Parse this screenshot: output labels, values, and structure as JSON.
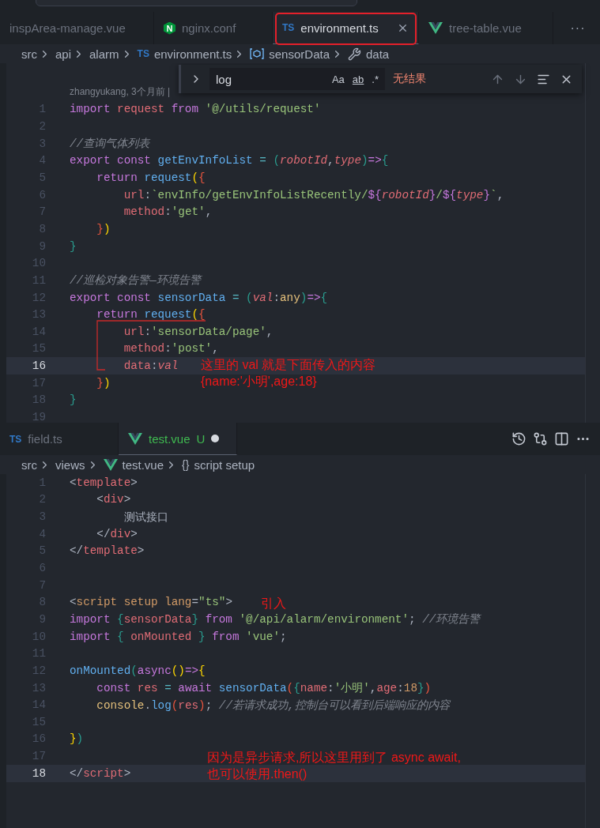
{
  "top_editor": {
    "tabs": [
      {
        "label": "inspArea-manage.vue",
        "selected": false
      },
      {
        "label": "nginx.conf",
        "kind": "nginx",
        "icon_text": "N",
        "selected": false
      },
      {
        "label": "environment.ts",
        "kind": "ts",
        "icon_text": "TS",
        "selected": true,
        "highlighted": true
      },
      {
        "label": "tree-table.vue",
        "kind": "vue",
        "selected": false
      }
    ],
    "more": "···",
    "breadcrumb": [
      {
        "label": "src"
      },
      {
        "label": "api"
      },
      {
        "label": "alarm"
      },
      {
        "label": "environment.ts",
        "kind": "ts",
        "icon_text": "TS"
      },
      {
        "label": "sensorData",
        "kind": "symbol"
      },
      {
        "label": "data",
        "kind": "wrench"
      }
    ],
    "find": {
      "value": "log",
      "options": [
        "Aa",
        "ab",
        ".*"
      ],
      "result": "无结果"
    },
    "blame": "zhangyukang, 3个月前 |",
    "lines": [
      {
        "n": "1",
        "current": false,
        "tokens": [
          {
            "kind": "kw",
            "text": "import "
          },
          {
            "kind": "var",
            "text": "request"
          },
          {
            "kind": "kw",
            "text": " from "
          },
          {
            "kind": "str",
            "text": "'@/utils/request'"
          }
        ]
      },
      {
        "n": "2",
        "current": false
      },
      {
        "n": "3",
        "current": false,
        "tokens": [
          {
            "kind": "comment",
            "text": "//查询气体列表"
          }
        ]
      },
      {
        "n": "4",
        "current": false,
        "tokens": [
          {
            "kind": "kw",
            "text": "export const "
          },
          {
            "kind": "fn",
            "text": "getEnvInfoList"
          },
          {
            "kind": "op",
            "text": " = "
          },
          {
            "kind": "b3",
            "text": "("
          },
          {
            "kind": "param",
            "text": "robotId"
          },
          {
            "kind": "plain",
            "text": ","
          },
          {
            "kind": "param",
            "text": "type"
          },
          {
            "kind": "b3",
            "text": ")"
          },
          {
            "kind": "kw",
            "text": "=>"
          },
          {
            "kind": "b3",
            "text": "{"
          }
        ]
      },
      {
        "n": "5",
        "current": false,
        "tokens": [
          {
            "kind": "kw",
            "text": "    return "
          },
          {
            "kind": "fn",
            "text": "request"
          },
          {
            "kind": "b1",
            "text": "("
          },
          {
            "kind": "b2",
            "text": "{"
          }
        ]
      },
      {
        "n": "6",
        "current": false,
        "tokens": [
          {
            "kind": "prop",
            "text": "        url"
          },
          {
            "kind": "plain",
            "text": ":"
          },
          {
            "kind": "str",
            "text": "`envInfo/getEnvInfoListRecently/"
          },
          {
            "kind": "kw",
            "text": "${"
          },
          {
            "kind": "param",
            "text": "robotId"
          },
          {
            "kind": "kw",
            "text": "}"
          },
          {
            "kind": "str",
            "text": "/"
          },
          {
            "kind": "kw",
            "text": "${"
          },
          {
            "kind": "param",
            "text": "type"
          },
          {
            "kind": "kw",
            "text": "}"
          },
          {
            "kind": "str",
            "text": "`"
          },
          {
            "kind": "plain",
            "text": ","
          }
        ]
      },
      {
        "n": "7",
        "current": false,
        "tokens": [
          {
            "kind": "prop",
            "text": "        method"
          },
          {
            "kind": "plain",
            "text": ":"
          },
          {
            "kind": "str",
            "text": "'get'"
          },
          {
            "kind": "plain",
            "text": ","
          }
        ]
      },
      {
        "n": "8",
        "current": false,
        "tokens": [
          {
            "kind": "b2",
            "text": "    }"
          },
          {
            "kind": "b1",
            "text": ")"
          }
        ]
      },
      {
        "n": "9",
        "current": false,
        "tokens": [
          {
            "kind": "b3",
            "text": "}"
          }
        ]
      },
      {
        "n": "10",
        "current": false
      },
      {
        "n": "11",
        "current": false,
        "tokens": [
          {
            "kind": "comment",
            "text": "//巡检对象告警—环境告警"
          }
        ]
      },
      {
        "n": "12",
        "current": false,
        "tokens": [
          {
            "kind": "kw",
            "text": "export const "
          },
          {
            "kind": "fn",
            "text": "sensorData"
          },
          {
            "kind": "op",
            "text": " = "
          },
          {
            "kind": "b3",
            "text": "("
          },
          {
            "kind": "param",
            "text": "val"
          },
          {
            "kind": "plain",
            "text": ":"
          },
          {
            "kind": "type",
            "text": "any"
          },
          {
            "kind": "b3",
            "text": ")"
          },
          {
            "kind": "kw",
            "text": "=>"
          },
          {
            "kind": "b3",
            "text": "{"
          }
        ]
      },
      {
        "n": "13",
        "current": false,
        "tokens": [
          {
            "kind": "kw",
            "text": "    return "
          },
          {
            "kind": "fn",
            "text": "request"
          },
          {
            "kind": "b1",
            "text": "("
          },
          {
            "kind": "b2",
            "text": "{"
          }
        ]
      },
      {
        "n": "14",
        "current": false,
        "tokens": [
          {
            "kind": "prop",
            "text": "        url"
          },
          {
            "kind": "plain",
            "text": ":"
          },
          {
            "kind": "str",
            "text": "'sensorData/page'"
          },
          {
            "kind": "plain",
            "text": ","
          }
        ]
      },
      {
        "n": "15",
        "current": false,
        "tokens": [
          {
            "kind": "prop",
            "text": "        method"
          },
          {
            "kind": "plain",
            "text": ":"
          },
          {
            "kind": "str",
            "text": "'post'"
          },
          {
            "kind": "plain",
            "text": ","
          }
        ]
      },
      {
        "n": "16",
        "current": true,
        "tokens": [
          {
            "kind": "prop",
            "text": "        data"
          },
          {
            "kind": "plain",
            "text": ":"
          },
          {
            "kind": "param",
            "text": "val"
          }
        ]
      },
      {
        "n": "17",
        "current": false,
        "tokens": [
          {
            "kind": "b2",
            "text": "    }"
          },
          {
            "kind": "b1",
            "text": ")"
          }
        ]
      },
      {
        "n": "18",
        "current": false,
        "tokens": [
          {
            "kind": "b3",
            "text": "}"
          }
        ]
      },
      {
        "n": "19",
        "current": false
      }
    ],
    "notes": [
      {
        "lines": [
          "这里的 val 就是下面传入的内容",
          "{name:'小明',age:18}"
        ]
      }
    ]
  },
  "bottom_editor": {
    "tabs": [
      {
        "label": "field.ts",
        "kind": "ts",
        "icon_text": "TS",
        "selected": false
      },
      {
        "label": "test.vue",
        "kind": "vue",
        "selected": true,
        "status": "U",
        "modified": true
      }
    ],
    "breadcrumb": [
      {
        "label": "src"
      },
      {
        "label": "views"
      },
      {
        "label": "test.vue",
        "kind": "vue"
      },
      {
        "label": "script setup",
        "kind": "text",
        "icon_text": "{}"
      }
    ],
    "lines": [
      {
        "n": "1",
        "current": false,
        "tokens": [
          {
            "kind": "punct",
            "text": "<"
          },
          {
            "kind": "tag",
            "text": "template"
          },
          {
            "kind": "punct",
            "text": ">"
          }
        ]
      },
      {
        "n": "2",
        "current": false,
        "tokens": [
          {
            "kind": "plain",
            "text": "    <"
          },
          {
            "kind": "tag",
            "text": "div"
          },
          {
            "kind": "punct",
            "text": ">"
          }
        ]
      },
      {
        "n": "3",
        "current": false,
        "tokens": [
          {
            "kind": "plain",
            "text": "        测试接口"
          }
        ]
      },
      {
        "n": "4",
        "current": false,
        "tokens": [
          {
            "kind": "plain",
            "text": "    </"
          },
          {
            "kind": "tag",
            "text": "div"
          },
          {
            "kind": "punct",
            "text": ">"
          }
        ]
      },
      {
        "n": "5",
        "current": false,
        "tokens": [
          {
            "kind": "punct",
            "text": "</"
          },
          {
            "kind": "tag",
            "text": "template"
          },
          {
            "kind": "punct",
            "text": ">"
          }
        ]
      },
      {
        "n": "6",
        "current": false
      },
      {
        "n": "7",
        "current": false
      },
      {
        "n": "8",
        "current": false,
        "tokens": [
          {
            "kind": "punct",
            "text": "<"
          },
          {
            "kind": "attr",
            "text": "script setup lang"
          },
          {
            "kind": "plain",
            "text": "="
          },
          {
            "kind": "str",
            "text": "\"ts\""
          },
          {
            "kind": "punct",
            "text": ">"
          }
        ]
      },
      {
        "n": "9",
        "current": false,
        "tokens": [
          {
            "kind": "kw",
            "text": "import "
          },
          {
            "kind": "b3",
            "text": "{"
          },
          {
            "kind": "var",
            "text": "sensorData"
          },
          {
            "kind": "b3",
            "text": "}"
          },
          {
            "kind": "kw",
            "text": " from "
          },
          {
            "kind": "str",
            "text": "'@/api/alarm/environment'"
          },
          {
            "kind": "plain",
            "text": "; "
          },
          {
            "kind": "comment",
            "text": "//环境告警"
          }
        ]
      },
      {
        "n": "10",
        "current": false,
        "tokens": [
          {
            "kind": "kw",
            "text": "import "
          },
          {
            "kind": "b3",
            "text": "{"
          },
          {
            "kind": "var",
            "text": " onMounted "
          },
          {
            "kind": "b3",
            "text": "}"
          },
          {
            "kind": "kw",
            "text": " from "
          },
          {
            "kind": "str",
            "text": "'vue'"
          },
          {
            "kind": "plain",
            "text": ";"
          }
        ]
      },
      {
        "n": "11",
        "current": false
      },
      {
        "n": "12",
        "current": false,
        "tokens": [
          {
            "kind": "fn",
            "text": "onMounted"
          },
          {
            "kind": "b3",
            "text": "("
          },
          {
            "kind": "kw",
            "text": "async"
          },
          {
            "kind": "b1",
            "text": "()"
          },
          {
            "kind": "kw",
            "text": "=>"
          },
          {
            "kind": "b1",
            "text": "{"
          }
        ]
      },
      {
        "n": "13",
        "current": false,
        "tokens": [
          {
            "kind": "kw",
            "text": "    const "
          },
          {
            "kind": "var",
            "text": "res"
          },
          {
            "kind": "op",
            "text": " = "
          },
          {
            "kind": "kw",
            "text": "await "
          },
          {
            "kind": "fn",
            "text": "sensorData"
          },
          {
            "kind": "b2",
            "text": "("
          },
          {
            "kind": "b3",
            "text": "{"
          },
          {
            "kind": "prop",
            "text": "name"
          },
          {
            "kind": "plain",
            "text": ":"
          },
          {
            "kind": "str",
            "text": "'小明'"
          },
          {
            "kind": "plain",
            "text": ","
          },
          {
            "kind": "prop",
            "text": "age"
          },
          {
            "kind": "plain",
            "text": ":"
          },
          {
            "kind": "num",
            "text": "18"
          },
          {
            "kind": "b3",
            "text": "}"
          },
          {
            "kind": "b2",
            "text": ")"
          }
        ]
      },
      {
        "n": "14",
        "current": false,
        "tokens": [
          {
            "kind": "type",
            "text": "    console"
          },
          {
            "kind": "plain",
            "text": "."
          },
          {
            "kind": "fn",
            "text": "log"
          },
          {
            "kind": "b2",
            "text": "("
          },
          {
            "kind": "var",
            "text": "res"
          },
          {
            "kind": "b2",
            "text": ")"
          },
          {
            "kind": "plain",
            "text": "; "
          },
          {
            "kind": "comment",
            "text": "//若请求成功,控制台可以看到后端响应的内容"
          }
        ]
      },
      {
        "n": "15",
        "current": false
      },
      {
        "n": "16",
        "current": false,
        "tokens": [
          {
            "kind": "b1",
            "text": "}"
          },
          {
            "kind": "b3",
            "text": ")"
          }
        ]
      },
      {
        "n": "17",
        "current": false
      },
      {
        "n": "18",
        "current": true,
        "tokens": [
          {
            "kind": "punct",
            "text": "</"
          },
          {
            "kind": "tag",
            "text": "script"
          },
          {
            "kind": "punct",
            "text": ">"
          }
        ]
      }
    ],
    "notes": [
      {
        "lines": [
          "引入"
        ]
      },
      {
        "lines": [
          "因为是异步请求,所以这里用到了 async await,",
          "也可以使用.then()"
        ]
      }
    ]
  }
}
